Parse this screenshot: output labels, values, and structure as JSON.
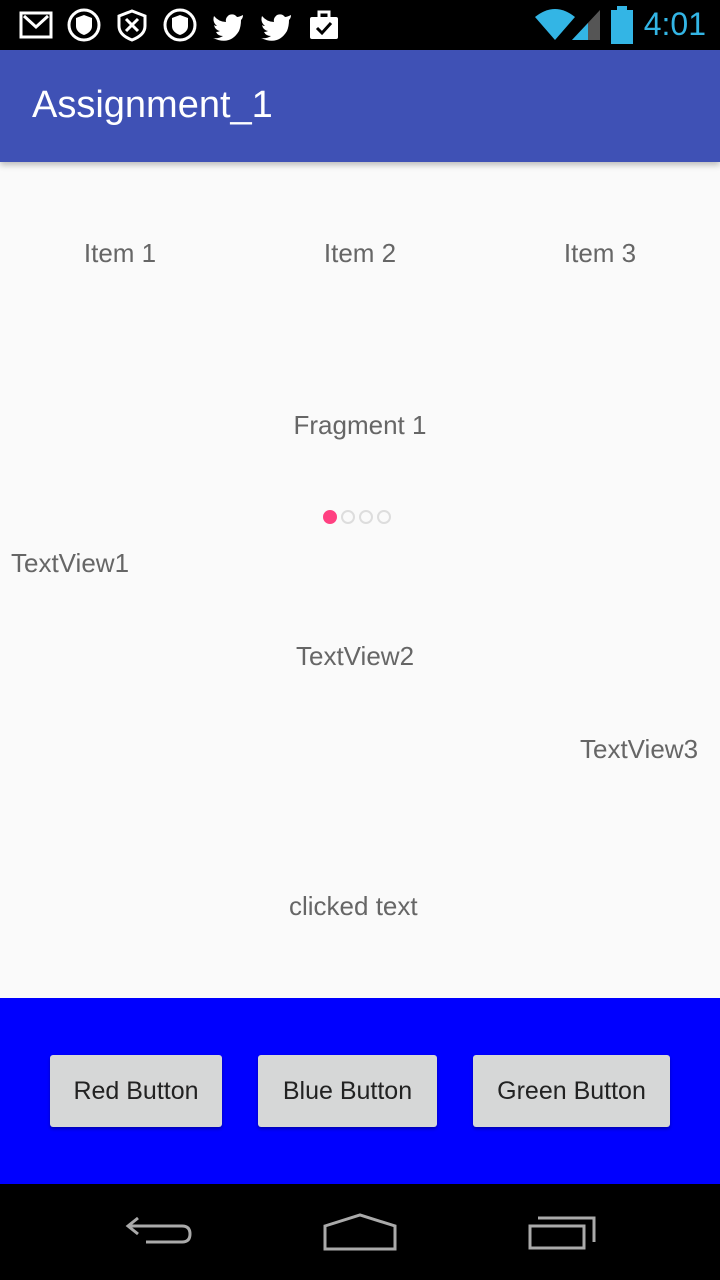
{
  "status_bar": {
    "time": "4:01",
    "notification_icons": [
      "gmail-icon",
      "shield-icon",
      "shield-icon",
      "shield-icon",
      "twitter-icon",
      "twitter-icon",
      "briefcase-icon"
    ],
    "accent_color": "#33b5e5"
  },
  "app_bar": {
    "title": "Assignment_1",
    "color": "#3f51b5"
  },
  "tabs": [
    {
      "label": "Item 1"
    },
    {
      "label": "Item 2"
    },
    {
      "label": "Item 3"
    }
  ],
  "fragment": {
    "label": "Fragment 1"
  },
  "page_indicator": {
    "count": 4,
    "active_index": 0,
    "active_color": "#ff4081"
  },
  "text_views": {
    "tv1": "TextView1",
    "tv2": "TextView2",
    "tv3": "TextView3",
    "clicked": "clicked text"
  },
  "buttons": {
    "panel_color": "#0000ff",
    "red": "Red Button",
    "blue": "Blue Button",
    "green": "Green Button"
  },
  "nav_bar": {
    "back_icon": "back-icon",
    "home_icon": "home-icon",
    "recents_icon": "recents-icon"
  }
}
